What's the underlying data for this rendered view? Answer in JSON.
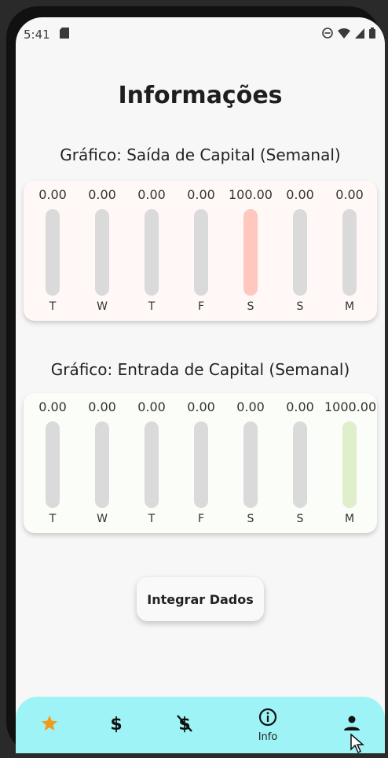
{
  "status": {
    "time": "5:41"
  },
  "page": {
    "title": "Informações"
  },
  "charts": [
    {
      "title": "Gráfico: Saída de Capital (Semanal)",
      "fill_color": "#ffc7bd",
      "days": [
        {
          "label": "T",
          "value_text": "0.00",
          "fraction": 0
        },
        {
          "label": "W",
          "value_text": "0.00",
          "fraction": 0
        },
        {
          "label": "T",
          "value_text": "0.00",
          "fraction": 0
        },
        {
          "label": "F",
          "value_text": "0.00",
          "fraction": 0
        },
        {
          "label": "S",
          "value_text": "100.00",
          "fraction": 1
        },
        {
          "label": "S",
          "value_text": "0.00",
          "fraction": 0
        },
        {
          "label": "M",
          "value_text": "0.00",
          "fraction": 0
        }
      ]
    },
    {
      "title": "Gráfico: Entrada de Capital (Semanal)",
      "fill_color": "#dfeecb",
      "days": [
        {
          "label": "T",
          "value_text": "0.00",
          "fraction": 0
        },
        {
          "label": "W",
          "value_text": "0.00",
          "fraction": 0
        },
        {
          "label": "T",
          "value_text": "0.00",
          "fraction": 0
        },
        {
          "label": "F",
          "value_text": "0.00",
          "fraction": 0
        },
        {
          "label": "S",
          "value_text": "0.00",
          "fraction": 0
        },
        {
          "label": "S",
          "value_text": "0.00",
          "fraction": 0
        },
        {
          "label": "M",
          "value_text": "1000.00",
          "fraction": 1
        }
      ]
    }
  ],
  "buttons": {
    "integrate": "Integrar Dados"
  },
  "nav": {
    "accent": "#f29a1a",
    "items": [
      {
        "icon": "star-icon"
      },
      {
        "icon": "dollar-icon"
      },
      {
        "icon": "dollar-off-icon"
      },
      {
        "icon": "info-icon",
        "label": "Info"
      },
      {
        "icon": "person-icon"
      }
    ]
  }
}
